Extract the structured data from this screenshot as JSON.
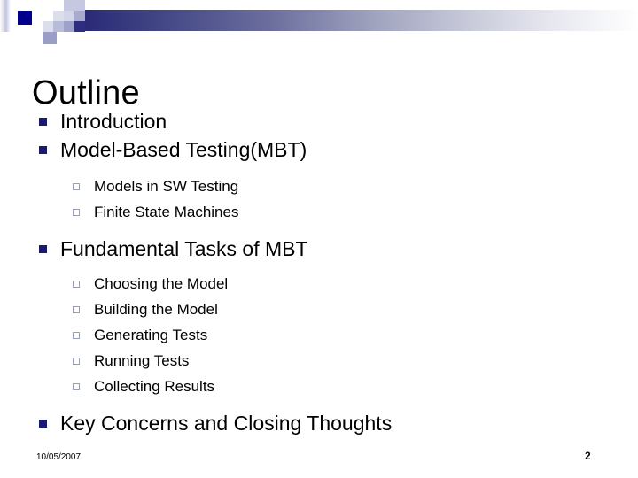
{
  "slide": {
    "title": "Outline",
    "page_number": "2",
    "date": "10/05/2007"
  },
  "theme": {
    "bullet_level1_color": "#191970",
    "bullet_level2_border_color": "#9a9fc0",
    "band_dark": "#2a2a78",
    "band_light": "#ffffff",
    "accent_square": "#00008b",
    "text_color": "#000000",
    "background": "#ffffff"
  },
  "outline": [
    {
      "level": 1,
      "label": "Introduction",
      "bullet": "solid-square-bullet"
    },
    {
      "level": 1,
      "label": "Model-Based Testing(MBT)",
      "bullet": "solid-square-bullet"
    },
    {
      "level": 2,
      "label": "Models in SW Testing",
      "bullet": "hollow-square-bullet"
    },
    {
      "level": 2,
      "label": "Finite State Machines",
      "bullet": "hollow-square-bullet"
    },
    {
      "level": 1,
      "label": "Fundamental Tasks of MBT",
      "bullet": "solid-square-bullet"
    },
    {
      "level": 2,
      "label": "Choosing the Model",
      "bullet": "hollow-square-bullet"
    },
    {
      "level": 2,
      "label": "Building the Model",
      "bullet": "hollow-square-bullet"
    },
    {
      "level": 2,
      "label": "Generating Tests",
      "bullet": "hollow-square-bullet"
    },
    {
      "level": 2,
      "label": "Running Tests",
      "bullet": "hollow-square-bullet"
    },
    {
      "level": 2,
      "label": "Collecting Results",
      "bullet": "hollow-square-bullet"
    },
    {
      "level": 1,
      "label": "Key Concerns and Closing Thoughts",
      "bullet": "solid-square-bullet"
    }
  ]
}
